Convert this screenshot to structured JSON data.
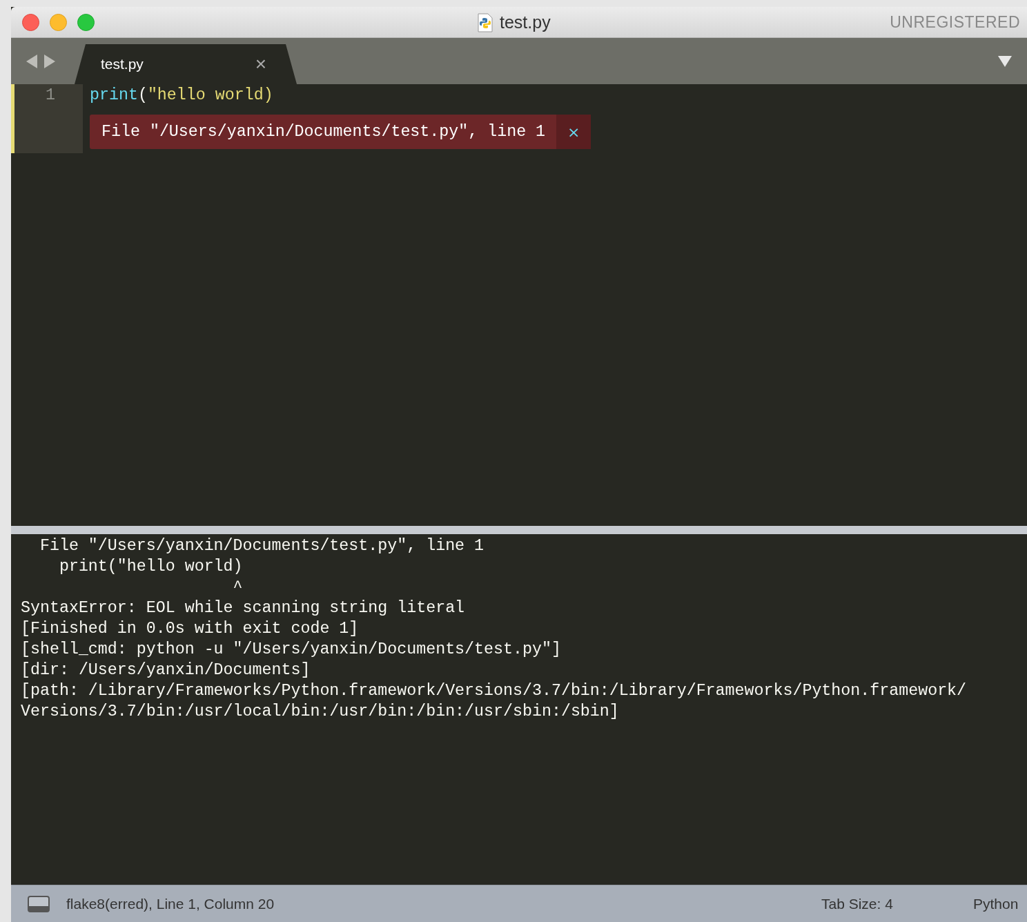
{
  "window": {
    "title": "test.py",
    "badge": "UNREGISTERED"
  },
  "tabs": [
    {
      "label": "test.py",
      "selected": true,
      "close": "×"
    }
  ],
  "editor": {
    "lines": [
      {
        "number": "1",
        "func": "print",
        "paren": "(",
        "string": "\"hello world)",
        "modified": true
      }
    ],
    "error_popup": {
      "message": "File \"/Users/yanxin/Documents/test.py\", line 1",
      "close": "×"
    }
  },
  "output": {
    "lines": [
      {
        "text": "  File \"/Users/yanxin/Documents/test.py\", line 1"
      },
      {
        "text": "    print(\"hello world)"
      },
      {
        "text": "                      ^"
      },
      {
        "text": "SyntaxError: EOL while scanning string literal"
      },
      {
        "text": "[Finished in 0.0s with exit code 1]"
      },
      {
        "text": "[shell_cmd: python -u \"/Users/yanxin/Documents/test.py\"]"
      },
      {
        "text": "[dir: /Users/yanxin/Documents]"
      },
      {
        "text": "[path: /Library/Frameworks/Python.framework/Versions/3.7/bin:/Library/Frameworks/Python.framework/"
      },
      {
        "text": "Versions/3.7/bin:/usr/local/bin:/usr/bin:/bin:/usr/sbin:/sbin]"
      }
    ]
  },
  "status_bar": {
    "message": "flake8(erred), Line 1, Column 20",
    "tab_size": "Tab Size: 4",
    "syntax": "Python"
  }
}
